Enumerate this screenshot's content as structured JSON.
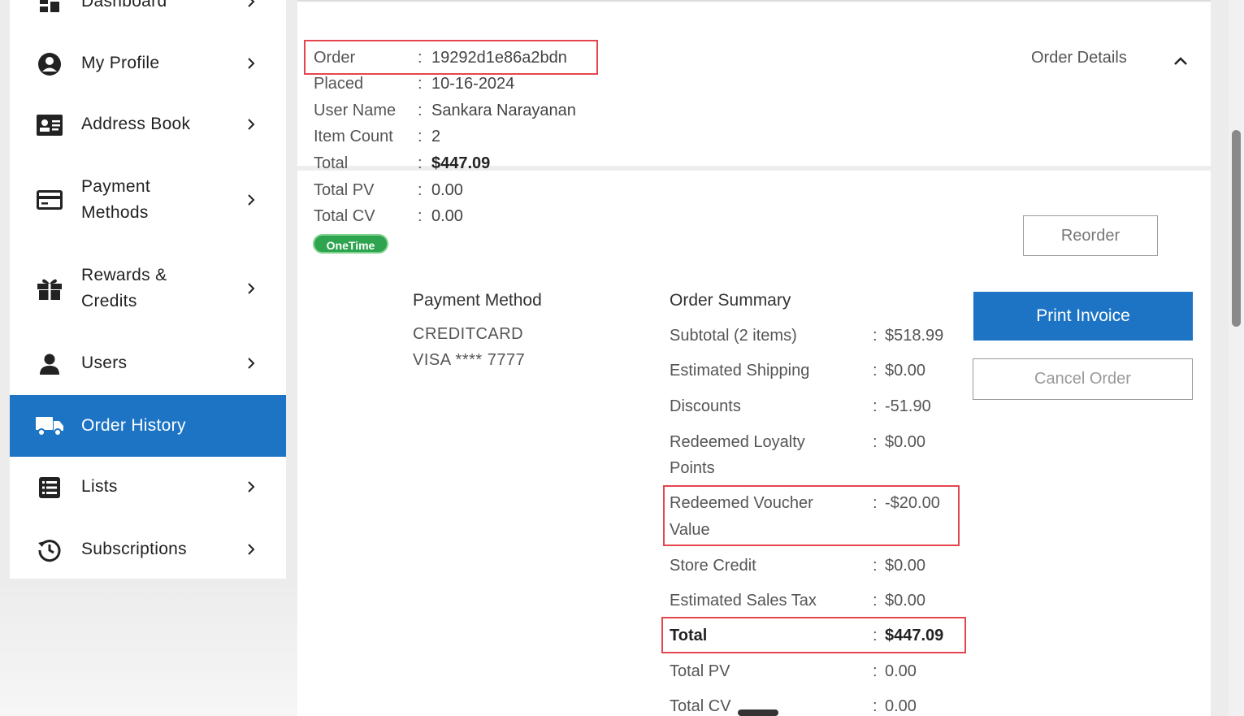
{
  "sidebar": {
    "items": [
      {
        "label": "Dashboard",
        "icon": "dashboard-icon",
        "active": false
      },
      {
        "label": "My Profile",
        "icon": "profile-icon",
        "active": false
      },
      {
        "label": "Address Book",
        "icon": "address-book-icon",
        "active": false
      },
      {
        "label_line1": "Payment",
        "label_line2": "Methods",
        "icon": "credit-card-icon",
        "active": false
      },
      {
        "label_line1": "Rewards &",
        "label_line2": "Credits",
        "icon": "gift-icon",
        "active": false
      },
      {
        "label": "Users",
        "icon": "user-icon",
        "active": false
      },
      {
        "label": "Order History",
        "icon": "truck-icon",
        "active": true
      },
      {
        "label": "Lists",
        "icon": "list-icon",
        "active": false
      },
      {
        "label": "Subscriptions",
        "icon": "history-icon",
        "active": false
      }
    ]
  },
  "order": {
    "fields": [
      {
        "key": "Order",
        "value": "19292d1e86a2bdn"
      },
      {
        "key": "Placed",
        "value": "10-16-2024"
      },
      {
        "key": "User Name",
        "value": "Sankara Narayanan"
      },
      {
        "key": "Item Count",
        "value": "2"
      },
      {
        "key": "Total",
        "value": "$447.09"
      },
      {
        "key": "Total PV",
        "value": "0.00"
      },
      {
        "key": "Total CV",
        "value": "0.00"
      }
    ],
    "separator": ":",
    "badge": "OneTime",
    "details_toggle": "Order Details"
  },
  "actions": {
    "reorder": "Reorder",
    "print_invoice": "Print Invoice",
    "cancel_order": "Cancel Order"
  },
  "payment_method": {
    "title": "Payment Method",
    "type": "CREDITCARD",
    "card": "VISA **** 7777"
  },
  "order_summary": {
    "title": "Order Summary",
    "rows": [
      {
        "label": "Subtotal (2 items)",
        "value": "$518.99"
      },
      {
        "label": "Estimated Shipping",
        "value": "$0.00"
      },
      {
        "label": "Discounts",
        "value": "-51.90"
      },
      {
        "label_line1": "Redeemed Loyalty",
        "label_line2": "Points",
        "value": "$0.00"
      },
      {
        "label_line1": "Redeemed Voucher",
        "label_line2": "Value",
        "value": "-$20.00"
      },
      {
        "label": "Store Credit",
        "value": "$0.00"
      },
      {
        "label": "Estimated Sales Tax",
        "value": "$0.00"
      },
      {
        "label": "Total",
        "value": "$447.09"
      },
      {
        "label": "Total PV",
        "value": "0.00"
      },
      {
        "label": "Total CV",
        "value": "0.00"
      }
    ]
  },
  "colors": {
    "accent": "#1d74c5",
    "highlight_border": "#e5454d",
    "badge_green": "#2ea44f"
  }
}
